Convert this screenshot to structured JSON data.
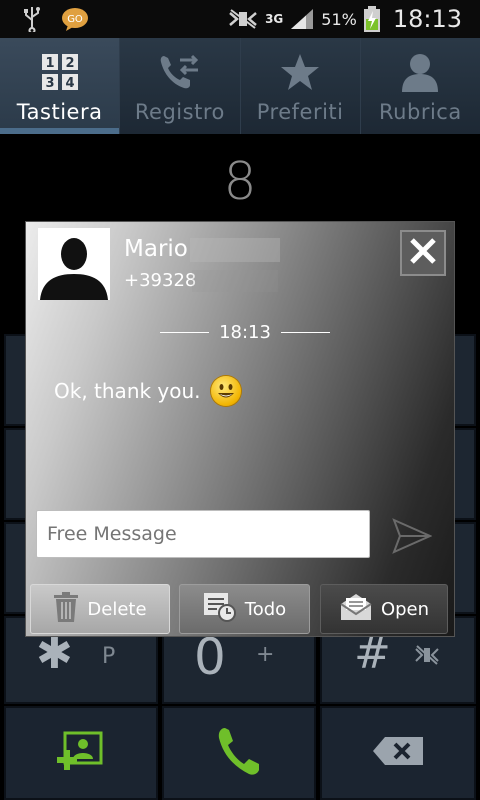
{
  "status_bar": {
    "battery_percent": "51%",
    "time": "18:13",
    "network": "3G"
  },
  "tabs": [
    {
      "label": "Tastiera",
      "icon": "keypad-icon",
      "active": true
    },
    {
      "label": "Registro",
      "icon": "call-log-icon",
      "active": false
    },
    {
      "label": "Preferiti",
      "icon": "star-icon",
      "active": false
    },
    {
      "label": "Rubrica",
      "icon": "contact-icon",
      "active": false
    }
  ],
  "dialer": {
    "display_value": "8",
    "keys": [
      {
        "symbol": "✱",
        "sub": "P"
      },
      {
        "symbol": "0",
        "sub": "+"
      },
      {
        "symbol": "#",
        "sub": ""
      }
    ]
  },
  "popup": {
    "contact_name": "Mario",
    "contact_number": "+39328",
    "time": "18:13",
    "message": "Ok, thank you.",
    "reply_placeholder": "Free Message",
    "actions": {
      "delete": "Delete",
      "todo": "Todo",
      "open": "Open"
    }
  },
  "colors": {
    "tab_bg": "#1d2834",
    "active_tab_indicator": "#4b6c8a",
    "call_green": "#6fbf2a",
    "keypad_bg": "#1d2631"
  }
}
